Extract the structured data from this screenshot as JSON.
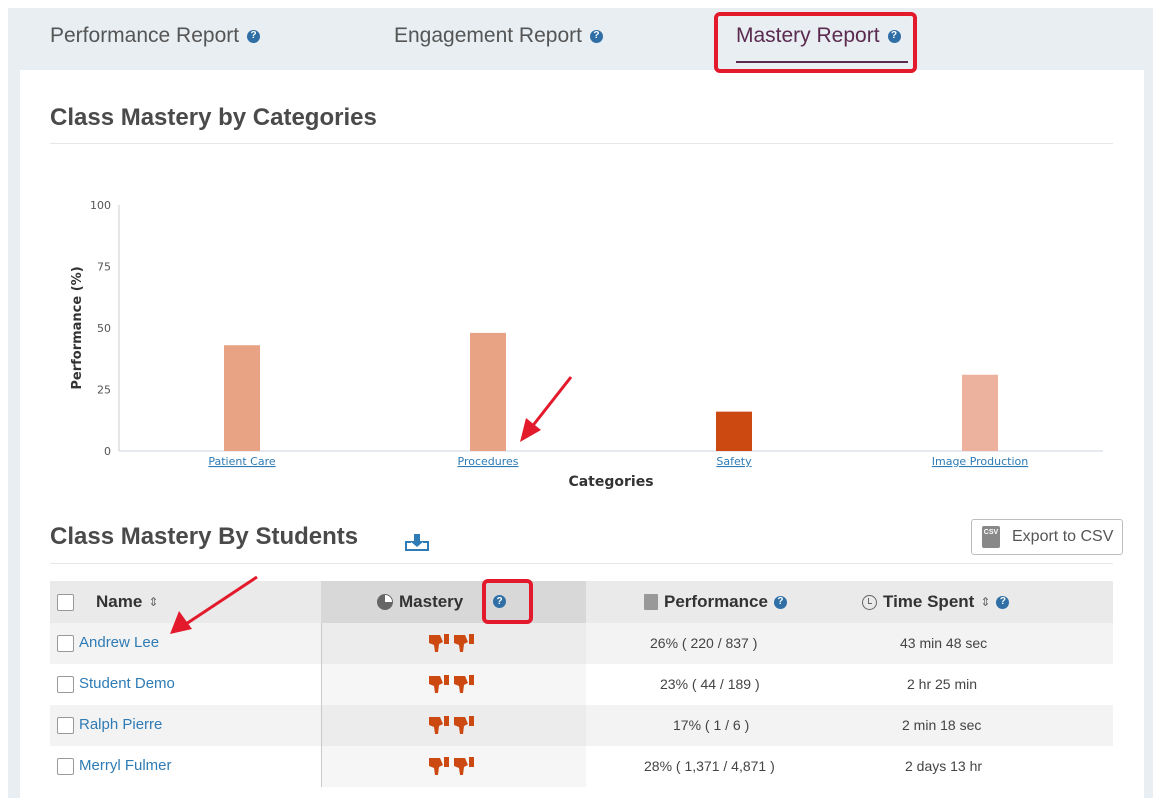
{
  "tabs": [
    {
      "label": "Performance Report",
      "active": false
    },
    {
      "label": "Engagement Report",
      "active": false
    },
    {
      "label": "Mastery Report",
      "active": true
    }
  ],
  "categories_section": {
    "title": "Class Mastery by Categories"
  },
  "chart_data": {
    "type": "bar",
    "categories": [
      "Patient Care",
      "Procedures",
      "Safety",
      "Image Production"
    ],
    "values": [
      43,
      48,
      16,
      31
    ],
    "bar_colors": [
      "#e8a384",
      "#e8a384",
      "#cc4a12",
      "#ecb29d"
    ],
    "xlabel": "Categories",
    "ylabel": "Performance (%)",
    "ylim": [
      0,
      100
    ],
    "yticks": [
      0,
      25,
      50,
      75,
      100
    ],
    "grid": false
  },
  "students_section": {
    "title": "Class Mastery By Students",
    "download_icon": "download-icon",
    "export_label": "Export to CSV"
  },
  "table": {
    "headers": {
      "name": "Name",
      "mastery": "Mastery",
      "performance": "Performance",
      "time": "Time Spent"
    },
    "rows": [
      {
        "name": "Andrew Lee",
        "mastery": "thumbs-down",
        "performance": "26%   ( 220 / 837 )",
        "time": "43 min 48 sec"
      },
      {
        "name": "Student Demo",
        "mastery": "thumbs-down",
        "performance": "23%   ( 44 / 189 )",
        "time": "2 hr 25 min"
      },
      {
        "name": "Ralph Pierre",
        "mastery": "thumbs-down",
        "performance": "17%   ( 1 / 6 )",
        "time": "2 min 18 sec"
      },
      {
        "name": "Merryl Fulmer",
        "mastery": "thumbs-down",
        "performance": "28%   ( 1,371 / 4,871 )",
        "time": "2 days 13 hr"
      }
    ]
  },
  "colors": {
    "accent": "#5b2a4f",
    "link": "#2e7bb5",
    "highlight": "#e21a2c",
    "thumb": "#cc4a12"
  }
}
